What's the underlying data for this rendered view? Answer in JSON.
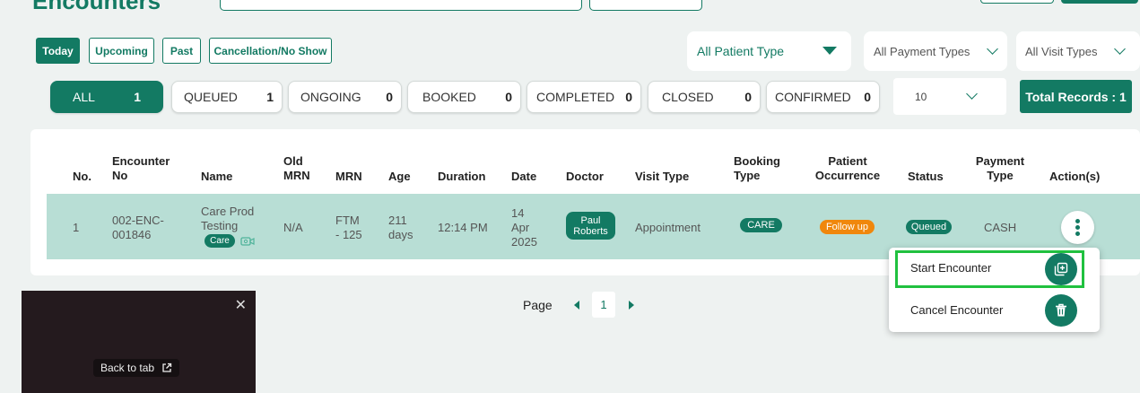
{
  "header": {
    "title": "Encounters"
  },
  "tabs": [
    {
      "label": "Today"
    },
    {
      "label": "Upcoming"
    },
    {
      "label": "Past"
    },
    {
      "label": "Cancellation/No Show"
    }
  ],
  "filters": {
    "patient_type": "All Patient Type",
    "payment_types": "All Payment Types",
    "visit_types": "All Visit Types"
  },
  "status_chips": [
    {
      "label": "ALL",
      "count": "1"
    },
    {
      "label": "QUEUED",
      "count": "1"
    },
    {
      "label": "ONGOING",
      "count": "0"
    },
    {
      "label": "BOOKED",
      "count": "0"
    },
    {
      "label": "COMPLETED",
      "count": "0"
    },
    {
      "label": "CLOSED",
      "count": "0"
    },
    {
      "label": "CONFIRMED",
      "count": "0"
    }
  ],
  "records_per_page": "10",
  "total_records": "Total Records : 1",
  "table": {
    "headers": {
      "no": "No.",
      "encounter_no_1": "Encounter",
      "encounter_no_2": "No",
      "name": "Name",
      "old_mrn_1": "Old",
      "old_mrn_2": "MRN",
      "mrn": "MRN",
      "age": "Age",
      "duration": "Duration",
      "date": "Date",
      "doctor": "Doctor",
      "visit_type": "Visit Type",
      "booking_type_1": "Booking",
      "booking_type_2": "Type",
      "patient_occurrence_1": "Patient",
      "patient_occurrence_2": "Occurrence",
      "status": "Status",
      "payment_type_1": "Payment",
      "payment_type_2": "Type",
      "actions": "Action(s)"
    },
    "rows": [
      {
        "no": "1",
        "encounter_no_1": "002-ENC-",
        "encounter_no_2": "001846",
        "name_1": "Care Prod",
        "name_2": "Testing",
        "name_tag": "Care",
        "old_mrn": "N/A",
        "mrn_1": "FTM",
        "mrn_2": "- 125",
        "age_1": "211",
        "age_2": "days",
        "duration": "12:14 PM",
        "date_1": "14",
        "date_2": "Apr",
        "date_3": "2025",
        "doctor_1": "Paul",
        "doctor_2": "Roberts",
        "visit_type": "Appointment",
        "booking_type": "CARE",
        "patient_occurrence": "Follow up",
        "status": "Queued",
        "payment_type": "CASH"
      }
    ]
  },
  "action_menu": {
    "start": "Start Encounter",
    "cancel": "Cancel Encounter"
  },
  "pagination": {
    "label": "Page",
    "current": "1"
  },
  "pip": {
    "back_to_tab": "Back to tab"
  },
  "colors": {
    "primary": "#137a63",
    "row_highlight": "#b8ded5",
    "follow_up": "#f0870c",
    "menu_highlight": "#20c13f"
  }
}
